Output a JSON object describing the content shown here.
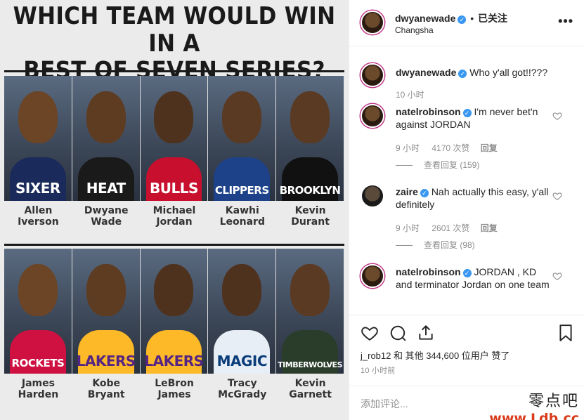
{
  "image": {
    "headline_line1": "WHICH TEAM WOULD WIN IN A",
    "headline_line2": "BEST OF SEVEN SERIES?",
    "team1": [
      {
        "first": "Allen",
        "last": "Iverson",
        "jersey": "SIXER",
        "color": "#1a2a5a",
        "skin": "#6b4526"
      },
      {
        "first": "Dwyane",
        "last": "Wade",
        "jersey": "HEAT",
        "color": "#1a1a1a",
        "skin": "#5e3c22"
      },
      {
        "first": "Michael",
        "last": "Jordan",
        "jersey": "BULLS",
        "color": "#c8102e",
        "skin": "#4e321e"
      },
      {
        "first": "Kawhi",
        "last": "Leonard",
        "jersey": "CLIPPERS",
        "color": "#1d428a",
        "skin": "#5a3a22"
      },
      {
        "first": "Kevin",
        "last": "Durant",
        "jersey": "BROOKLYN",
        "color": "#111111",
        "skin": "#5a3a22"
      }
    ],
    "team2": [
      {
        "first": "James",
        "last": "Harden",
        "jersey": "ROCKETS",
        "color": "#ce1141",
        "skin": "#6b4526"
      },
      {
        "first": "Kobe",
        "last": "Bryant",
        "jersey": "LAKERS",
        "color": "#fdb927",
        "skin": "#5e3c22"
      },
      {
        "first": "LeBron",
        "last": "James",
        "jersey": "LAKERS",
        "color": "#fdb927",
        "skin": "#4e321e"
      },
      {
        "first": "Tracy",
        "last": "McGrady",
        "jersey": "MAGIC",
        "color": "#e8eef5",
        "skin": "#4e321e"
      },
      {
        "first": "Kevin",
        "last": "Garnett",
        "jersey": "TIMBERWOLVES",
        "color": "#2a3d2a",
        "skin": "#5a3a22"
      }
    ]
  },
  "header": {
    "username": "dwyanewade",
    "separator": "•",
    "follow_status": "已关注",
    "location": "Changsha",
    "more": "•••"
  },
  "comments": [
    {
      "username": "dwyanewade",
      "text": "Who y'all got!!???",
      "time": "10 小时"
    },
    {
      "username": "natelrobinson",
      "text": "I'm never bet'n against JORDAN",
      "time": "9 小时",
      "likes": "4170 次赞",
      "reply": "回复",
      "view_replies": "查看回复 (159)"
    },
    {
      "username": "zaire",
      "text": "Nah actually this easy, y'all definitely",
      "time": "9 小时",
      "likes": "2601 次赞",
      "reply": "回复",
      "view_replies": "查看回复 (98)"
    },
    {
      "username": "natelrobinson",
      "text": "JORDAN , KD and terminator Jordan on one team"
    }
  ],
  "footer": {
    "likes_text": "j_rob12 和 其他 344,600 位用户 赞了",
    "time": "10 小时前",
    "comment_placeholder": "添加评论...",
    "watermark_cn": "零点吧",
    "watermark_url": "www.Ldb.cc"
  },
  "colors": {
    "verified": "#3897f0",
    "muted": "#8e8e8e",
    "text": "#262626"
  }
}
